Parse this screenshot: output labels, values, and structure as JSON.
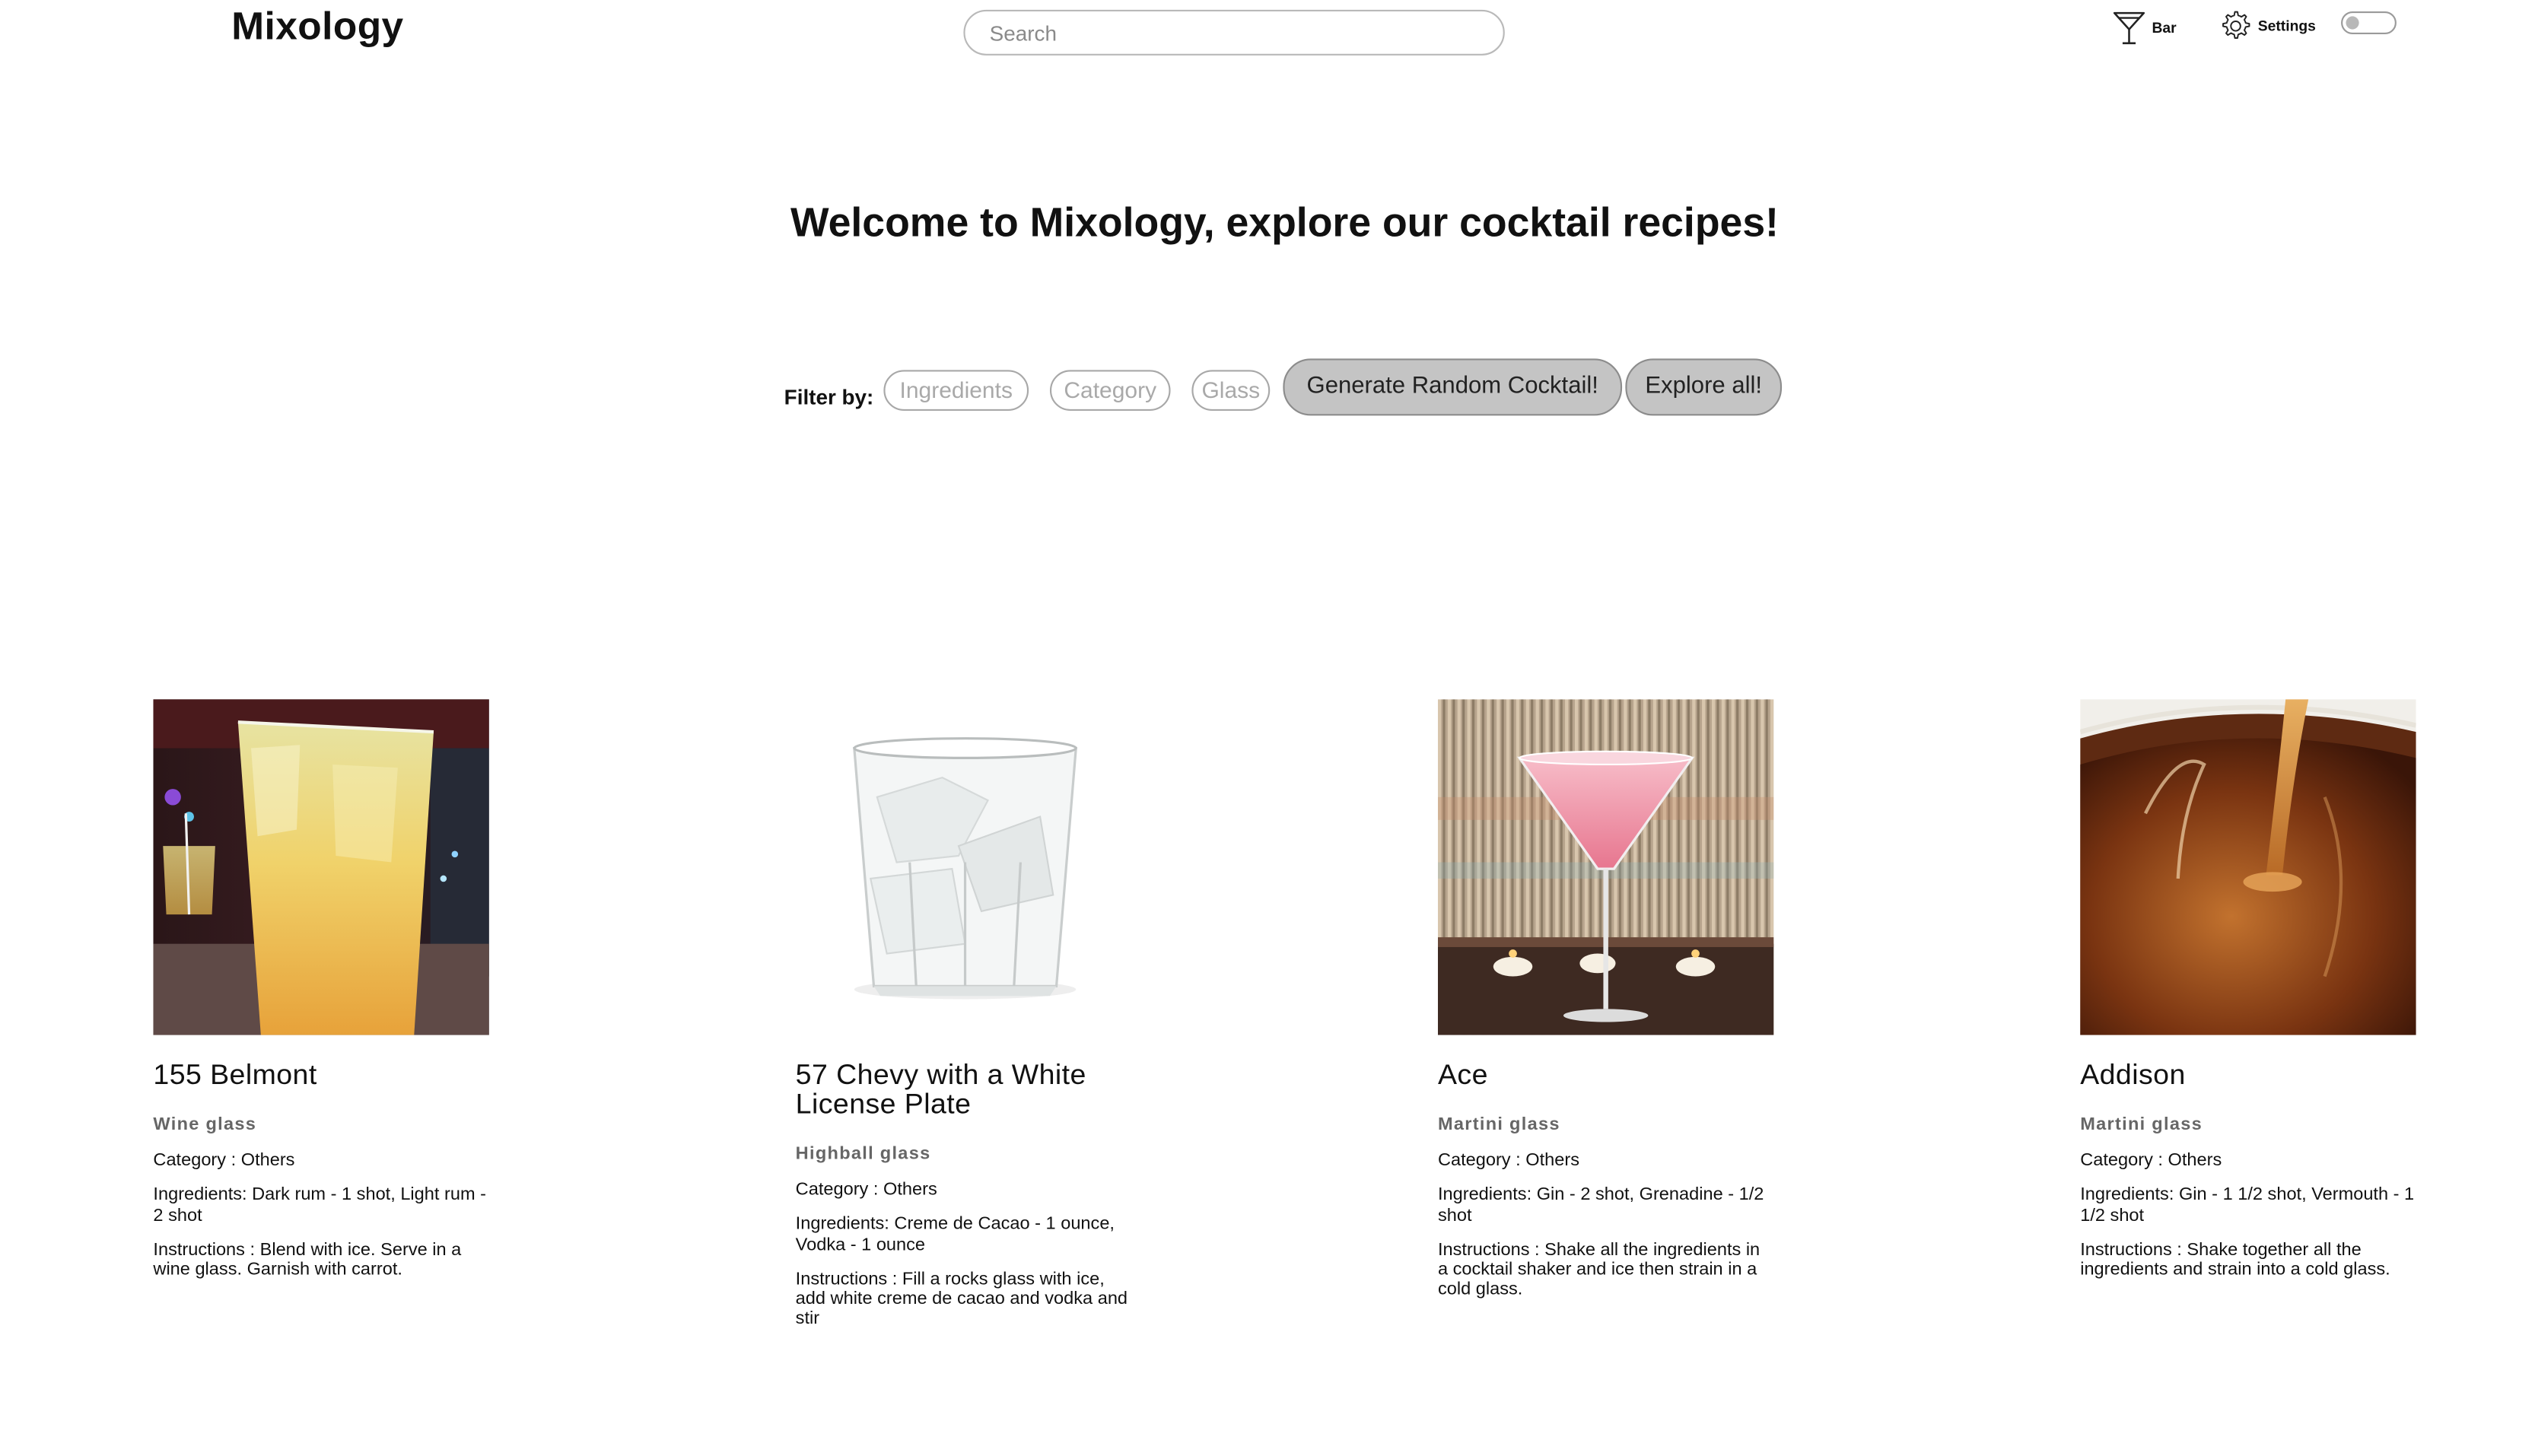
{
  "header": {
    "brand": "Mixology",
    "search_placeholder": "Search",
    "nav": {
      "bar_label": "Bar",
      "settings_label": "Settings"
    },
    "theme_toggle": {
      "state": "off"
    }
  },
  "welcome": "Welcome to Mixology, explore our cocktail recipes!",
  "filters": {
    "label": "Filter by:",
    "chips": [
      "Ingredients",
      "Category",
      "Glass"
    ],
    "random_button": "Generate Random Cocktail!",
    "explore_button": "Explore all!"
  },
  "cards": [
    {
      "name": "155 Belmont",
      "glass": "Wine glass",
      "category_label": "Category :",
      "category": "Others",
      "ingredients_label": "Ingredients:",
      "ingredients": "Dark rum - 1 shot, Light rum - 2 shot",
      "instructions_label": "Instructions :",
      "instructions": "Blend with ice. Serve in a wine glass. Garnish with carrot."
    },
    {
      "name": "57 Chevy with a White License Plate",
      "glass": "Highball glass",
      "category_label": "Category :",
      "category": "Others",
      "ingredients_label": "Ingredients:",
      "ingredients": "Creme de Cacao - 1 ounce, Vodka - 1 ounce",
      "instructions_label": "Instructions :",
      "instructions": "Fill a rocks glass with ice, add white creme de cacao and vodka and stir"
    },
    {
      "name": "Ace",
      "glass": "Martini glass",
      "category_label": "Category :",
      "category": "Others",
      "ingredients_label": "Ingredients:",
      "ingredients": "Gin - 2 shot, Grenadine - 1/2 shot",
      "instructions_label": "Instructions :",
      "instructions": "Shake all the ingredients in a cocktail shaker and ice then strain in a cold glass."
    },
    {
      "name": "Addison",
      "glass": "Martini glass",
      "category_label": "Category :",
      "category": "Others",
      "ingredients_label": "Ingredients:",
      "ingredients": "Gin - 1 1/2 shot, Vermouth - 1 1/2 shot",
      "instructions_label": "Instructions :",
      "instructions": "Shake together all the ingredients and strain into a cold glass."
    }
  ],
  "colors": {
    "button_fill": "#c4c4c4",
    "chip_text": "#a9a9a9",
    "glass_label": "#666666"
  }
}
